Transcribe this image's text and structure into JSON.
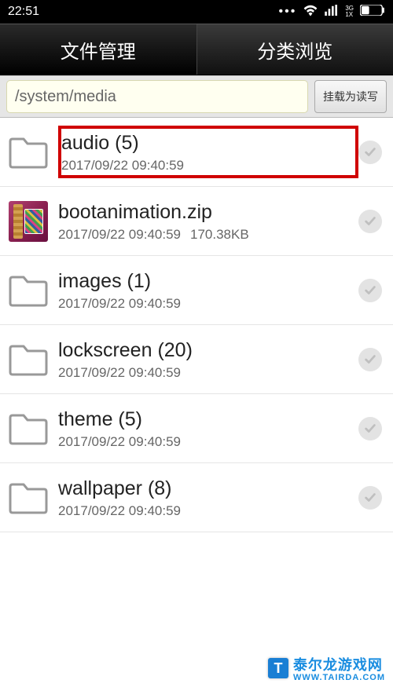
{
  "status": {
    "time": "22:51",
    "network_label": "3G",
    "network_sub": "1X"
  },
  "tabs": {
    "file_mgr": "文件管理",
    "category": "分类浏览"
  },
  "path": "/system/media",
  "mount_btn": "挂载为读写",
  "files": [
    {
      "name": "audio  (5)",
      "date": "2017/09/22 09:40:59",
      "size": "",
      "type": "folder",
      "highlighted": true
    },
    {
      "name": "bootanimation.zip",
      "date": "2017/09/22 09:40:59",
      "size": "170.38KB",
      "type": "zip",
      "highlighted": false
    },
    {
      "name": "images  (1)",
      "date": "2017/09/22 09:40:59",
      "size": "",
      "type": "folder",
      "highlighted": false
    },
    {
      "name": "lockscreen  (20)",
      "date": "2017/09/22 09:40:59",
      "size": "",
      "type": "folder",
      "highlighted": false
    },
    {
      "name": "theme  (5)",
      "date": "2017/09/22 09:40:59",
      "size": "",
      "type": "folder",
      "highlighted": false
    },
    {
      "name": "wallpaper  (8)",
      "date": "2017/09/22 09:40:59",
      "size": "",
      "type": "folder",
      "highlighted": false
    }
  ],
  "watermark": {
    "main": "泰尔龙游戏网",
    "sub": "WWW.TAIRDA.COM"
  }
}
